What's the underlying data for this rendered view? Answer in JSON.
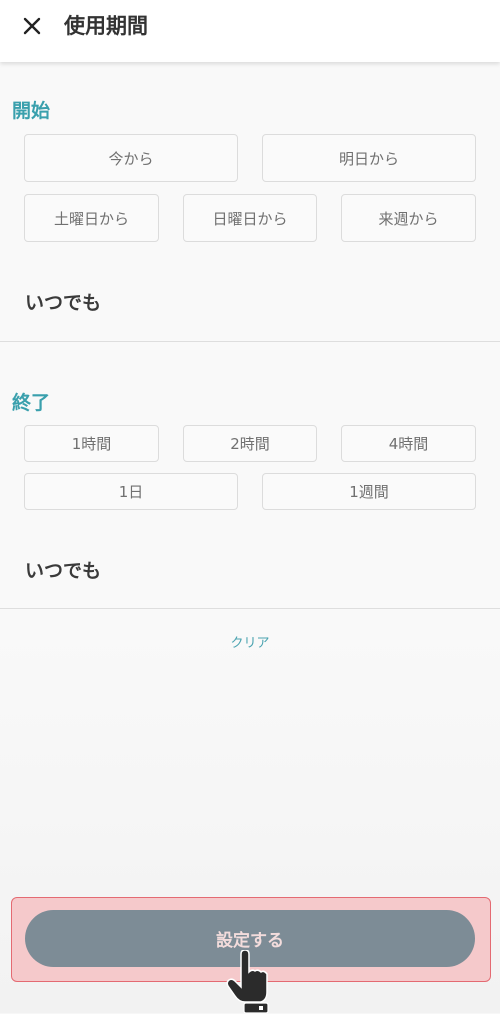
{
  "header": {
    "title": "使用期間"
  },
  "start": {
    "label": "開始",
    "options_row1": [
      "今から",
      "明日から"
    ],
    "options_row2": [
      "土曜日から",
      "日曜日から",
      "来週から"
    ],
    "anytime": "いつでも"
  },
  "end": {
    "label": "終了",
    "options_row1": [
      "1時間",
      "2時間",
      "4時間"
    ],
    "options_row2": [
      "1日",
      "1週間"
    ],
    "anytime": "いつでも"
  },
  "clear_label": "クリア",
  "submit_label": "設定する",
  "colors": {
    "accent": "#3aa0ad",
    "button": "#7d8c96",
    "highlight_bg": "#f5c9cb",
    "highlight_border": "#e46a72"
  }
}
